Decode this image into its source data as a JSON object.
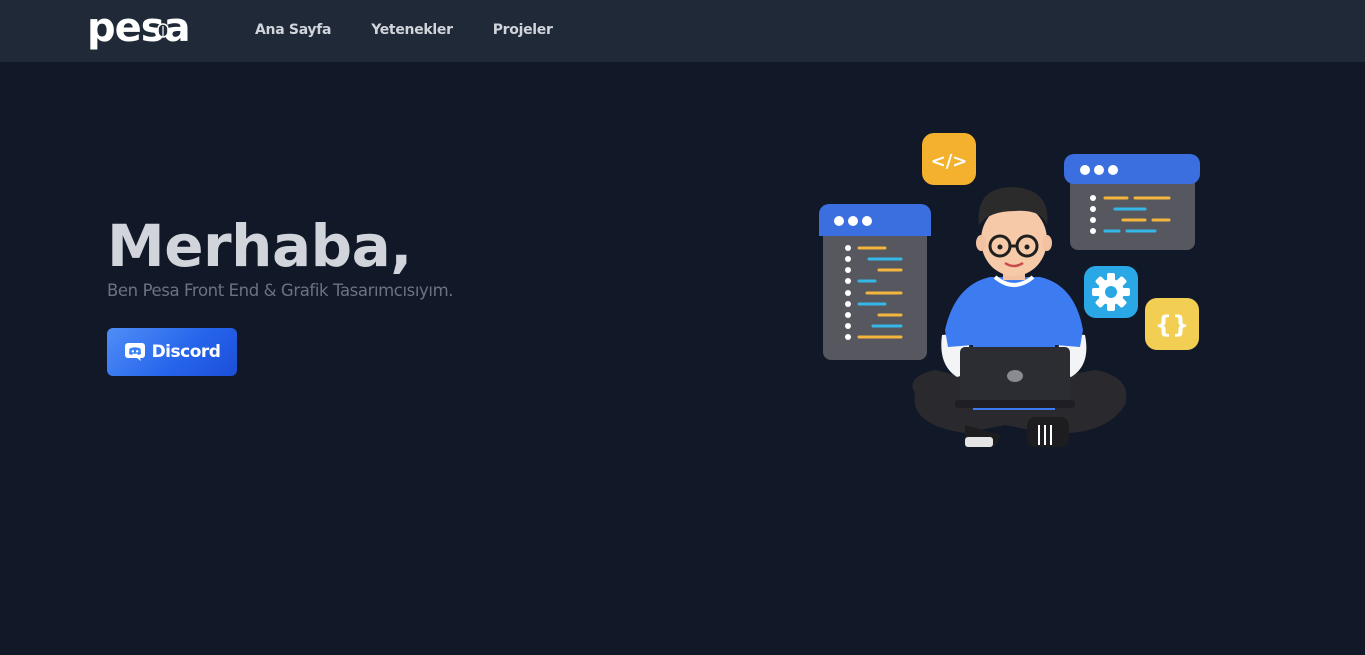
{
  "navbar": {
    "logo": "pesa",
    "links": [
      {
        "label": "Ana Sayfa"
      },
      {
        "label": "Yetenekler"
      },
      {
        "label": "Projeler"
      }
    ]
  },
  "hero": {
    "title": "Merhaba,",
    "subtitle": "Ben Pesa Front End & Grafik Tasarımcısıyım.",
    "button_label": "Discord"
  },
  "illustration": {
    "code_badge": "</>",
    "braces_badge": "{}"
  },
  "colors": {
    "background": "#111827",
    "navbar": "#1f2937",
    "accent": "#2563eb"
  },
  "icons": {
    "logo_mark": "bug-icon",
    "button": "discord-icon"
  }
}
